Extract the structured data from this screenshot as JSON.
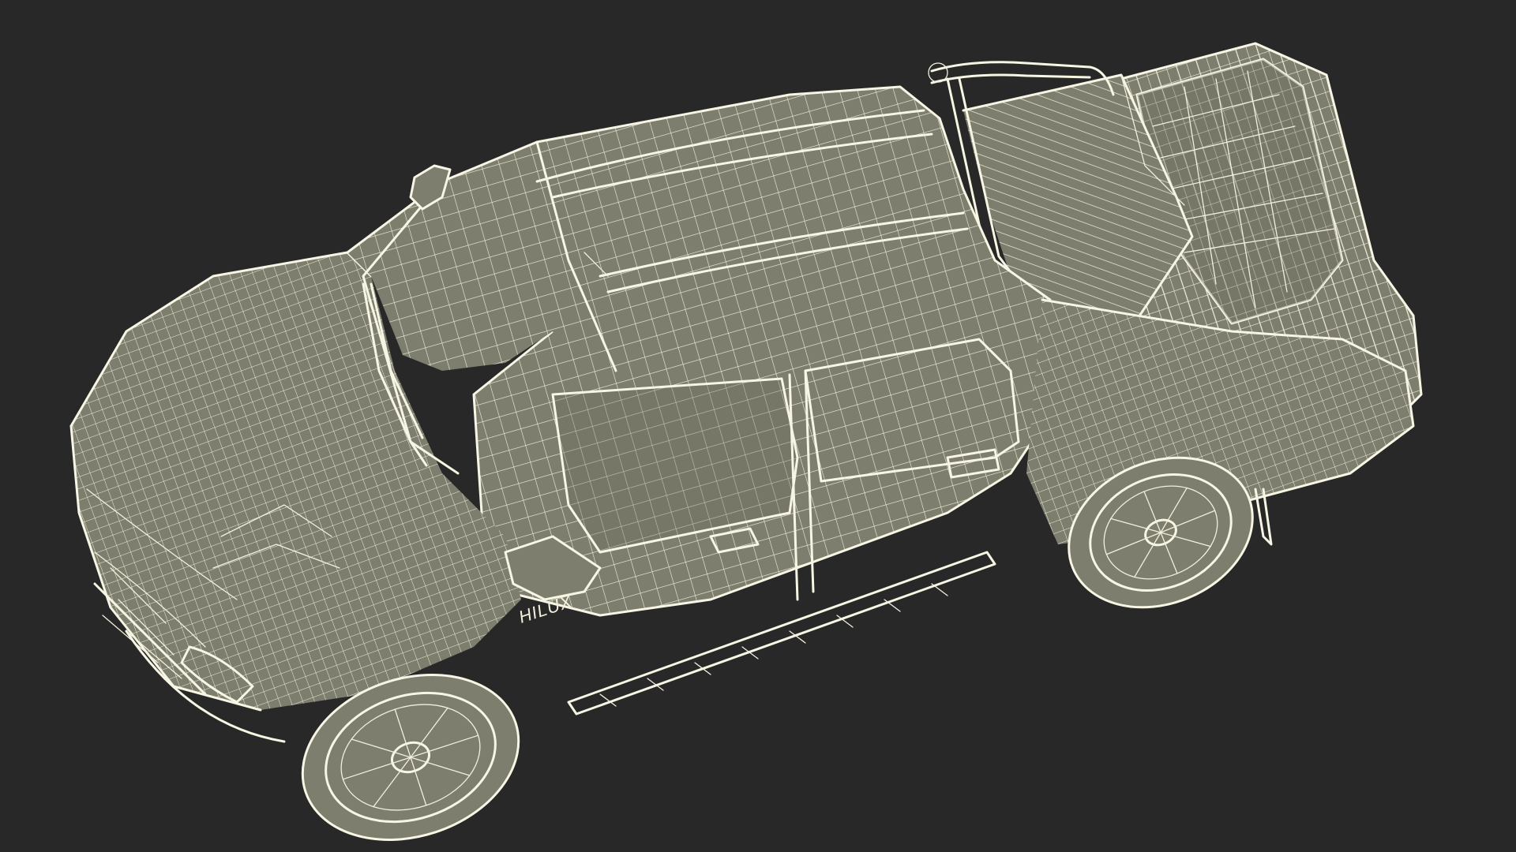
{
  "scene": {
    "background_color": "#282828",
    "mesh_color": "#7e7e6f",
    "wire_color": "#f2f0dc",
    "badge_text": "HILUX"
  }
}
